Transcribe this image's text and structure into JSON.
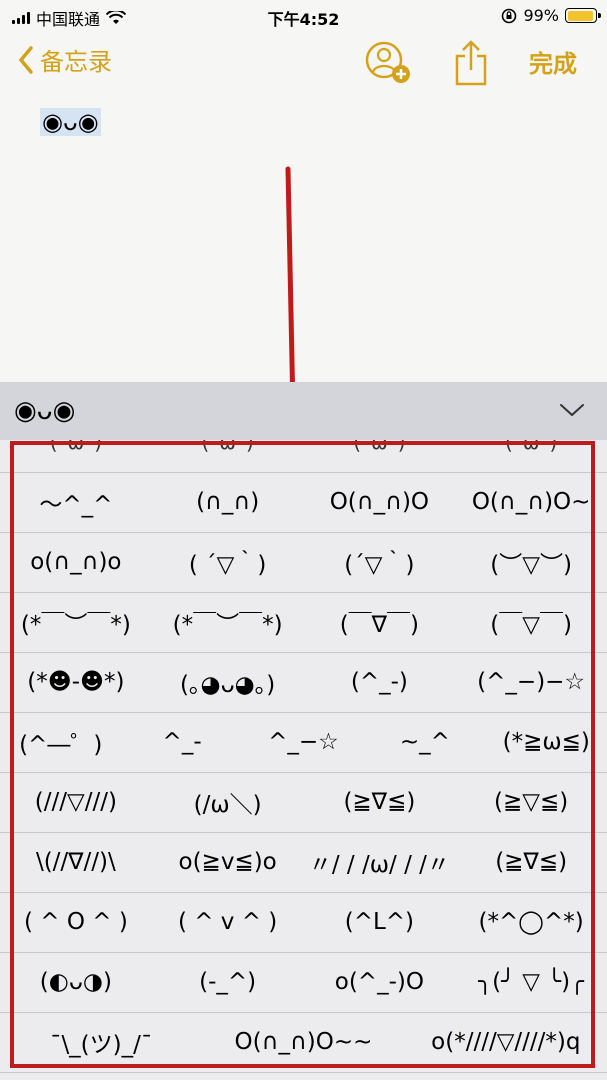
{
  "status_bar": {
    "carrier": "中国联通",
    "time": "下午4:52",
    "battery_percent": "99%",
    "battery_level": 0.99
  },
  "nav": {
    "back_label": "备忘录",
    "done_label": "完成"
  },
  "note": {
    "content": "◉ᴗ◉"
  },
  "keyboard": {
    "header_label": "◉ᴗ◉",
    "rows": [
      [
        "(´ω`)",
        "(´ω`)",
        "(´ω`)",
        "(´ω`)"
      ],
      [
        "～^_^",
        "(∩_∩)",
        "O(∩_∩)O",
        "O(∩_∩)O~"
      ],
      [
        "o(∩_∩)o",
        "( ´▽｀)",
        "(´▽｀)",
        "(︶▽︶)"
      ],
      [
        "(*￣︶￣*)",
        "(*￣︶￣*)",
        "(￣∇￣)",
        "(￣▽￣)"
      ],
      [
        "(*☻-☻*)",
        "(｡◕ᴗ◕｡)",
        "(^_-)",
        "(^_−)−☆"
      ],
      [
        "(^―゜)",
        "^_-",
        "^_−☆",
        "~_^",
        "(*≧ω≦)"
      ],
      [
        "(///▽///)",
        "(/ω＼)",
        "(≧∇≦)",
        "(≧▽≦)"
      ],
      [
        "\\(//∇//)\\",
        "o(≧v≦)o",
        "〃/ / /ω/ / /〃",
        "(≧∇≦)"
      ],
      [
        "( ^ O ^ )",
        "( ^ v ^ )",
        "(^L^)",
        "(*^◯^*)"
      ],
      [
        "(◐ᴗ◑)",
        "(-_^)",
        "o(^_-)O",
        "╮(╯ ▽ ╰)╭"
      ],
      [
        "¯\\_(ツ)_/¯",
        "O(∩_∩)O~~",
        "o(*////▽////*)q"
      ]
    ]
  }
}
